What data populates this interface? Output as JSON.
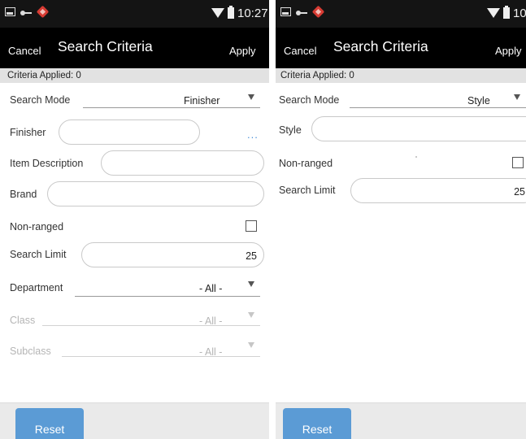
{
  "status_bar": {
    "time": "10:27"
  },
  "screens": [
    {
      "cancel_label": "Cancel",
      "title": "Search Criteria",
      "apply_label": "Apply",
      "criteria_applied": "Criteria Applied: 0",
      "search_mode": {
        "label": "Search Mode",
        "value": "Finisher"
      },
      "finisher": {
        "label": "Finisher",
        "value": "",
        "lookup": "..."
      },
      "item_description": {
        "label": "Item Description",
        "value": ""
      },
      "brand": {
        "label": "Brand",
        "value": ""
      },
      "non_ranged": {
        "label": "Non-ranged",
        "checked": false
      },
      "search_limit": {
        "label": "Search Limit",
        "value": "25"
      },
      "department": {
        "label": "Department",
        "value": "- All -"
      },
      "class": {
        "label": "Class",
        "value": "- All -"
      },
      "subclass": {
        "label": "Subclass",
        "value": "- All -"
      },
      "reset_label": "Reset"
    },
    {
      "cancel_label": "Cancel",
      "title": "Search Criteria",
      "apply_label": "Apply",
      "criteria_applied": "Criteria Applied: 0",
      "search_mode": {
        "label": "Search Mode",
        "value": "Style"
      },
      "style": {
        "label": "Style",
        "value": ""
      },
      "non_ranged": {
        "label": "Non-ranged",
        "checked": false
      },
      "search_limit": {
        "label": "Search Limit",
        "value": "25"
      },
      "reset_label": "Reset"
    }
  ],
  "colors": {
    "app_bar": "#000000",
    "status_bar": "#141414",
    "accent": "#5b9bd5",
    "criteria_bar": "#e2e2e2"
  }
}
